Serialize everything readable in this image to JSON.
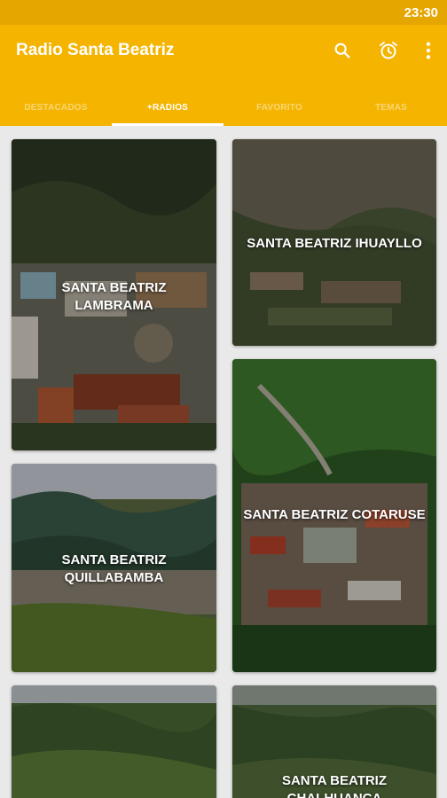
{
  "status_bar": {
    "time": "23:30"
  },
  "app_bar": {
    "title": "Radio Santa Beatriz",
    "icons": [
      "search-icon",
      "alarm-icon",
      "more-vert-icon"
    ]
  },
  "tabs": [
    {
      "label": "DESTACADOS",
      "active": false
    },
    {
      "label": "+RADIOS",
      "active": true
    },
    {
      "label": "FAVORITO",
      "active": false
    },
    {
      "label": "TEMAS",
      "active": false
    }
  ],
  "cards": [
    {
      "line1": "SANTA BEATRIZ",
      "line2": "LAMBRAMA"
    },
    {
      "line1": "SANTA BEATRIZ IHUAYLLO",
      "line2": ""
    },
    {
      "line1": "SANTA BEATRIZ",
      "line2": "QUILLABAMBA"
    },
    {
      "line1": "SANTA BEATRIZ COTARUSE",
      "line2": ""
    },
    {
      "line1": "",
      "line2": ""
    },
    {
      "line1": "SANTA BEATRIZ",
      "line2": "CHALHUANCA"
    }
  ],
  "colors": {
    "primary": "#f4b400",
    "status_bar": "#e6a600",
    "background": "#e9e9e9"
  }
}
